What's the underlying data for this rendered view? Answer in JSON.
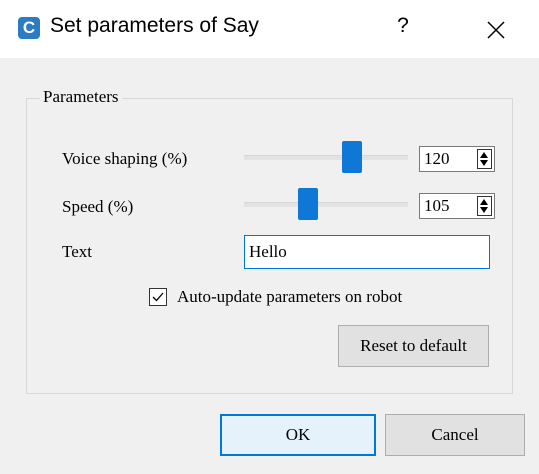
{
  "window": {
    "title": "Set parameters of Say",
    "app_icon_letter": "C",
    "help_label": "?",
    "icons": {
      "app": "choregraphe-app-icon",
      "close": "close-icon"
    }
  },
  "parameters_group": {
    "title": "Parameters",
    "voice_shaping": {
      "label": "Voice shaping (%)",
      "value": "120",
      "slider_fraction": 0.66
    },
    "speed": {
      "label": "Speed (%)",
      "value": "105",
      "slider_fraction": 0.39
    },
    "text": {
      "label": "Text",
      "value": "Hello"
    },
    "auto_update": {
      "label": "Auto-update parameters on robot",
      "checked": true
    },
    "reset_label": "Reset to default"
  },
  "footer": {
    "ok_label": "OK",
    "cancel_label": "Cancel"
  },
  "colors": {
    "accent": "#0078d7",
    "slider_thumb": "#0f78d7",
    "dialog_bg": "#f0f0f0"
  }
}
